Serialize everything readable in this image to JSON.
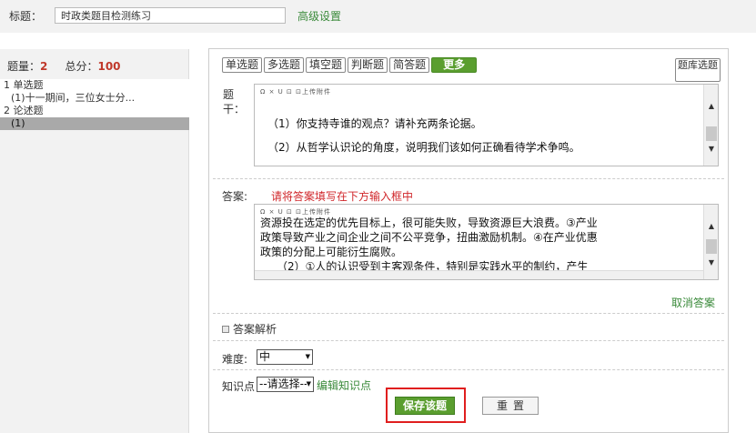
{
  "header": {
    "title_label": "标题：",
    "title_value": "时政类题目检测练习",
    "advanced_link": "高级设置"
  },
  "sidebar": {
    "count_label": "题量：",
    "count_value": "2",
    "score_label": "总分：",
    "score_value": "100",
    "tree": [
      {
        "label": "1 单选题",
        "level": 0
      },
      {
        "label": "(1)十一期间，三位女士分...",
        "level": 1
      },
      {
        "label": "2 论述题",
        "level": 0
      },
      {
        "label": "(1)",
        "level": 1,
        "selected": true
      }
    ]
  },
  "types": {
    "single": "单选题",
    "multi": "多选题",
    "fill": "填空题",
    "judge": "判断题",
    "short": "简答题",
    "more": "更多",
    "bank": "题库选题"
  },
  "stem": {
    "label": "题干：",
    "toolbar": "Ω  ×  U  ⊡  ⊡上传附件",
    "lines": [
      "（1）你支持寺谁的观点？请补充两条论据。",
      "（2）从哲学认识论的角度，说明我们该如何正确看待学术争鸣。"
    ]
  },
  "answer": {
    "label": "答案:",
    "hint": "请将答案填写在下方输入框中",
    "toolbar": "Ω  ×  U  ⊡  ⊡上传附件",
    "lines": [
      "资源投在选定的优先目标上，很可能失败，导致资源巨大浪费。③产业",
      "政策导致产业之间企业之间不公平竞争，扭曲激励机制。④在产业优惠",
      "政策的分配上可能衍生腐败。",
      "　　（2）①人的认识受到主客观条件，特别是实践水平的制约，产生"
    ],
    "cancel": "取消答案"
  },
  "analysis": {
    "label": "答案解析"
  },
  "difficulty": {
    "label": "难度:",
    "value": "中"
  },
  "knowledge": {
    "label": "知识点",
    "value": "--请选择--",
    "edit": "编辑知识点"
  },
  "actions": {
    "save": "保存该题",
    "reset": "重置"
  }
}
